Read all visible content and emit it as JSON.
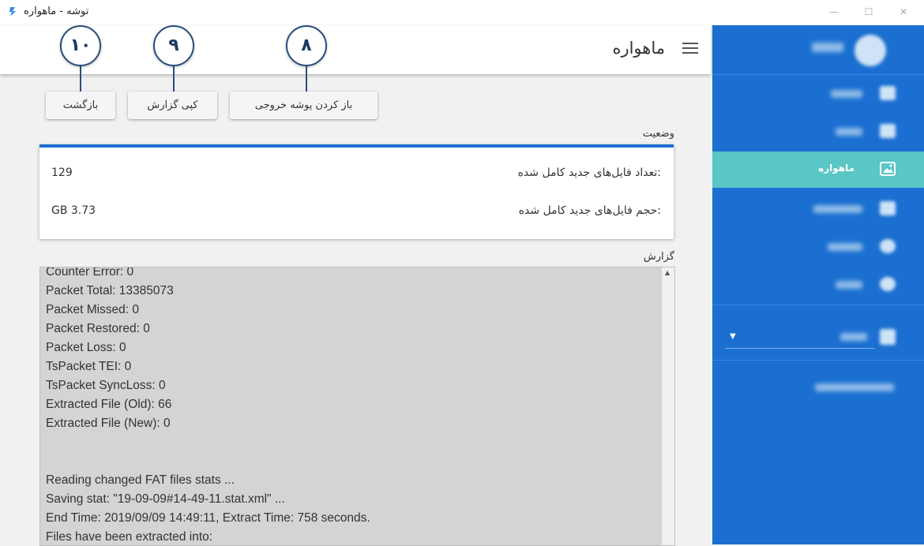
{
  "window": {
    "title": "توشه - ماهواره",
    "controls": [
      "—",
      "☐",
      "✕"
    ]
  },
  "sidebar": {
    "active_item": "ماهواره"
  },
  "header": {
    "page_title": "ماهواره"
  },
  "toolbar": {
    "open_output_label": "باز کردن پوشه خروجی",
    "copy_report_label": "کپی گزارش",
    "back_label": "بازگشت"
  },
  "callouts": {
    "open_output": "۸",
    "copy_report": "۹",
    "back": "۱۰"
  },
  "status": {
    "section_label": "وضعیت",
    "new_files_count_label": "تعداد فایل‌های جدید کامل شده:",
    "new_files_count_value": "129",
    "new_files_size_label": "حجم فایل‌های جدید کامل شده:",
    "new_files_size_value": "GB 3.73"
  },
  "report": {
    "section_label": "گزارش",
    "lines": [
      "Counter Error: 0",
      "Packet Total: 13385073",
      "Packet Missed: 0",
      "Packet Restored: 0",
      "Packet Loss: 0",
      "TsPacket TEI: 0",
      "TsPacket SyncLoss: 0",
      "Extracted File (Old): 66",
      "Extracted File (New): 0",
      "",
      "",
      "Reading changed FAT files stats ...",
      "Saving stat: \"19-09-09#14-49-11.stat.xml\" ...",
      "End Time: 2019/09/09 14:49:11, Extract Time: 758 seconds.",
      "Files have been extracted into:"
    ]
  },
  "colors": {
    "sidebar_bg": "#1a6fd1",
    "active_item_bg": "#5ac6c6",
    "status_accent": "#1a6fd1",
    "callout_border": "#2a4d7c"
  }
}
